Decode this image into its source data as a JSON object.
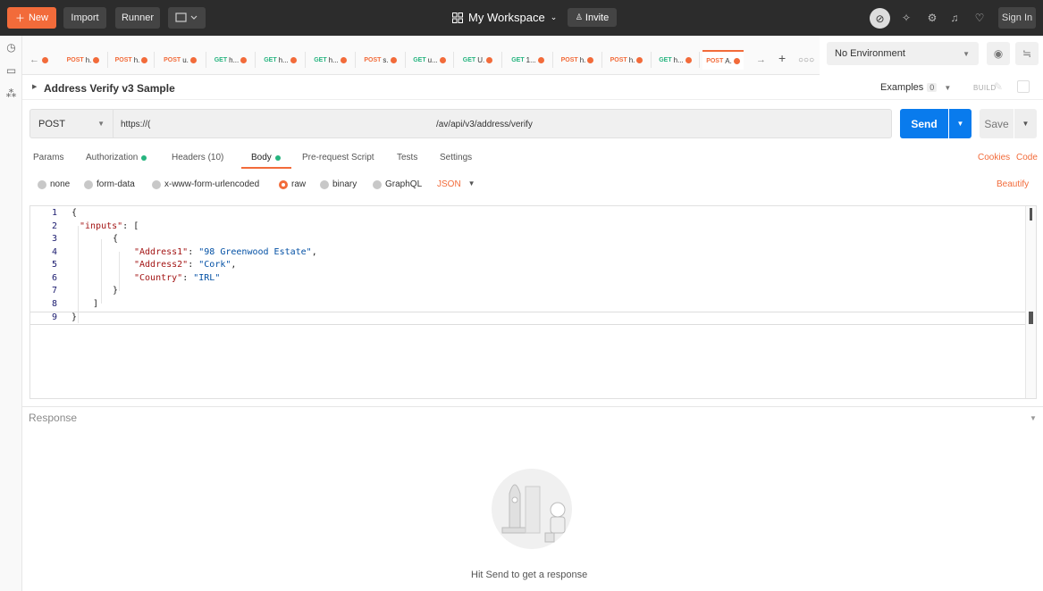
{
  "topbar": {
    "new_label": "New",
    "import_label": "Import",
    "runner_label": "Runner",
    "workspace_label": "My Workspace",
    "invite_label": "Invite",
    "signin_label": "Sign In"
  },
  "tabs": [
    {
      "method": "POST",
      "name": "h."
    },
    {
      "method": "POST",
      "name": "h."
    },
    {
      "method": "POST",
      "name": "u."
    },
    {
      "method": "GET",
      "name": "h..."
    },
    {
      "method": "GET",
      "name": "h..."
    },
    {
      "method": "GET",
      "name": "h..."
    },
    {
      "method": "POST",
      "name": "s."
    },
    {
      "method": "GET",
      "name": "u..."
    },
    {
      "method": "GET",
      "name": "U."
    },
    {
      "method": "GET",
      "name": "1..."
    },
    {
      "method": "POST",
      "name": "h."
    },
    {
      "method": "POST",
      "name": "h."
    },
    {
      "method": "GET",
      "name": "h..."
    },
    {
      "method": "POST",
      "name": "A."
    }
  ],
  "environment": {
    "selected": "No Environment"
  },
  "request": {
    "name": "Address Verify v3 Sample",
    "examples_label": "Examples",
    "examples_count": "0",
    "build_label": "BUILD",
    "method": "POST",
    "url_start": "https://(",
    "url_end": "/av/api/v3/address/verify",
    "send_label": "Send",
    "save_label": "Save"
  },
  "request_tabs": {
    "params": "Params",
    "authorization": "Authorization",
    "headers": "Headers (10)",
    "body": "Body",
    "prerequest": "Pre-request Script",
    "tests": "Tests",
    "settings": "Settings",
    "cookies": "Cookies",
    "code": "Code"
  },
  "body_types": {
    "none": "none",
    "formdata": "form-data",
    "urlencoded": "x-www-form-urlencoded",
    "raw": "raw",
    "binary": "binary",
    "graphql": "GraphQL",
    "format": "JSON",
    "beautify": "Beautify"
  },
  "editor": {
    "line_numbers": [
      "1",
      "2",
      "3",
      "4",
      "5",
      "6",
      "7",
      "8",
      "9"
    ],
    "key_inputs": "\"inputs\"",
    "key_address1": "\"Address1\"",
    "val_address1": "\"98 Greenwood Estate\"",
    "key_address2": "\"Address2\"",
    "val_address2": "\"Cork\"",
    "key_country": "\"Country\"",
    "val_country": "\"IRL\""
  },
  "response": {
    "label": "Response",
    "empty_hint": "Hit Send to get a response"
  },
  "colors": {
    "accent": "#f26b3a",
    "send_blue": "#097bed",
    "topbar": "#2c2c2c",
    "status_green": "#26b47f"
  }
}
